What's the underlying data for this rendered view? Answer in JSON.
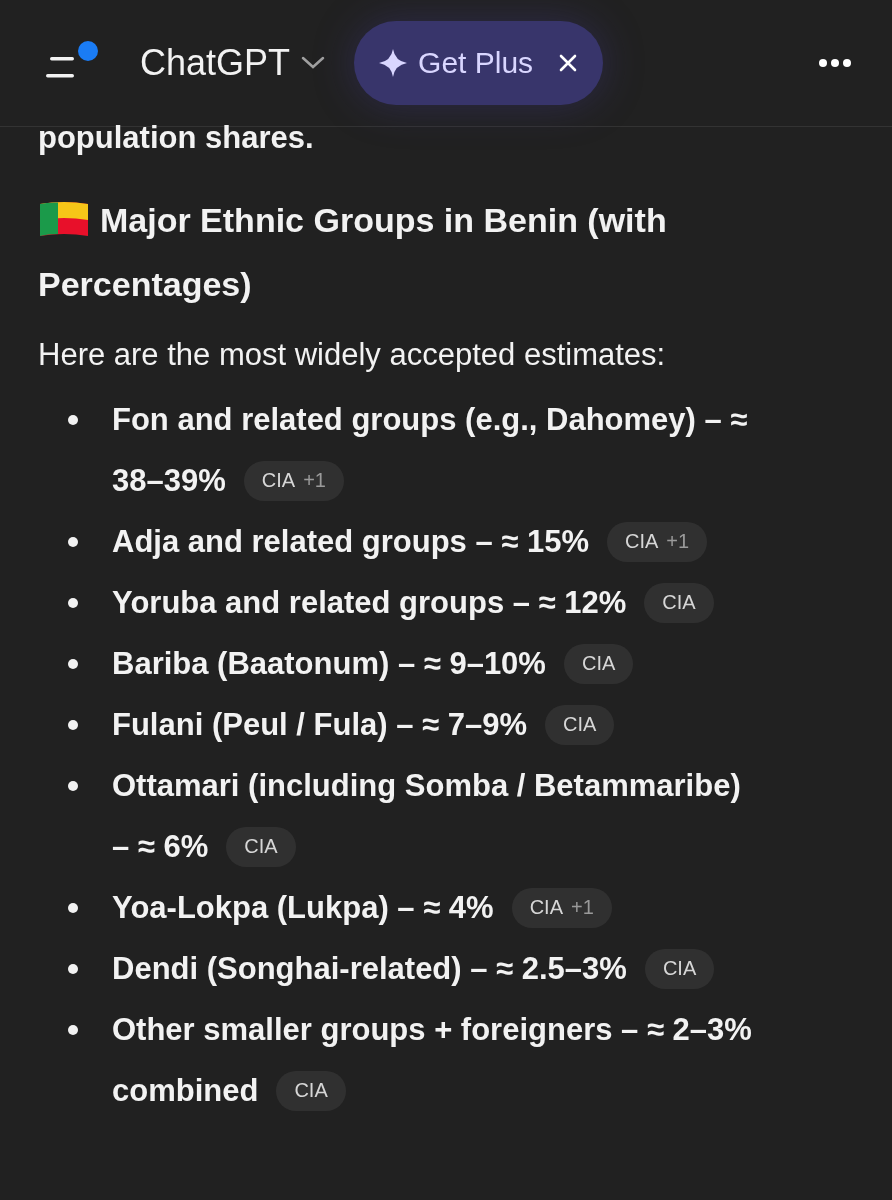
{
  "header": {
    "title": "ChatGPT",
    "notification_dot": true,
    "promo": {
      "label": "Get Plus"
    }
  },
  "intro_tail": "population shares.",
  "heading_lines": [
    "Major Ethnic Groups in Benin (with",
    "Percentages)"
  ],
  "lead": "Here are the most widely accepted estimates:",
  "items": [
    {
      "lines": [
        "Fon and related groups (e.g., Dahomey) – ≈",
        "38–39%"
      ],
      "source": "CIA",
      "extra": "+1"
    },
    {
      "lines": [
        "Adja and related groups – ≈ 15%"
      ],
      "source": "CIA",
      "extra": "+1"
    },
    {
      "lines": [
        "Yoruba and related groups – ≈ 12%"
      ],
      "source": "CIA"
    },
    {
      "lines": [
        "Bariba (Baatonum) – ≈ 9–10%"
      ],
      "source": "CIA"
    },
    {
      "lines": [
        "Fulani (Peul / Fula) – ≈ 7–9%"
      ],
      "source": "CIA"
    },
    {
      "lines": [
        "Ottamari (including Somba / Betammaribe)",
        "– ≈ 6%"
      ],
      "source": "CIA"
    },
    {
      "lines": [
        "Yoa-Lokpa (Lukpa) – ≈ 4%"
      ],
      "source": "CIA",
      "extra": "+1"
    },
    {
      "lines": [
        "Dendi (Songhai-related) – ≈ 2.5–3%"
      ],
      "source": "CIA"
    },
    {
      "lines": [
        "Other smaller groups + foreigners – ≈ 2–3%",
        "combined"
      ],
      "source": "CIA"
    }
  ]
}
